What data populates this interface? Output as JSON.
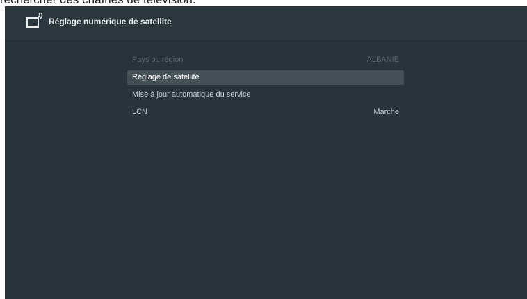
{
  "caption": "rechercher des chaînes de télévision.",
  "header": {
    "title": "Réglage numérique de satellite",
    "icon": "tv-antenna-icon"
  },
  "menu": {
    "items": [
      {
        "label": "Pays ou région",
        "value": "ALBANIE",
        "state": "disabled"
      },
      {
        "label": "Réglage de satellite",
        "value": "",
        "state": "selected"
      },
      {
        "label": "Mise à jour automatique du service",
        "value": "",
        "state": "normal"
      },
      {
        "label": "LCN",
        "value": "Marche",
        "state": "normal"
      }
    ]
  },
  "colors": {
    "background": "#28333a",
    "selected": "#465157",
    "disabled_text": "#5d6870"
  }
}
